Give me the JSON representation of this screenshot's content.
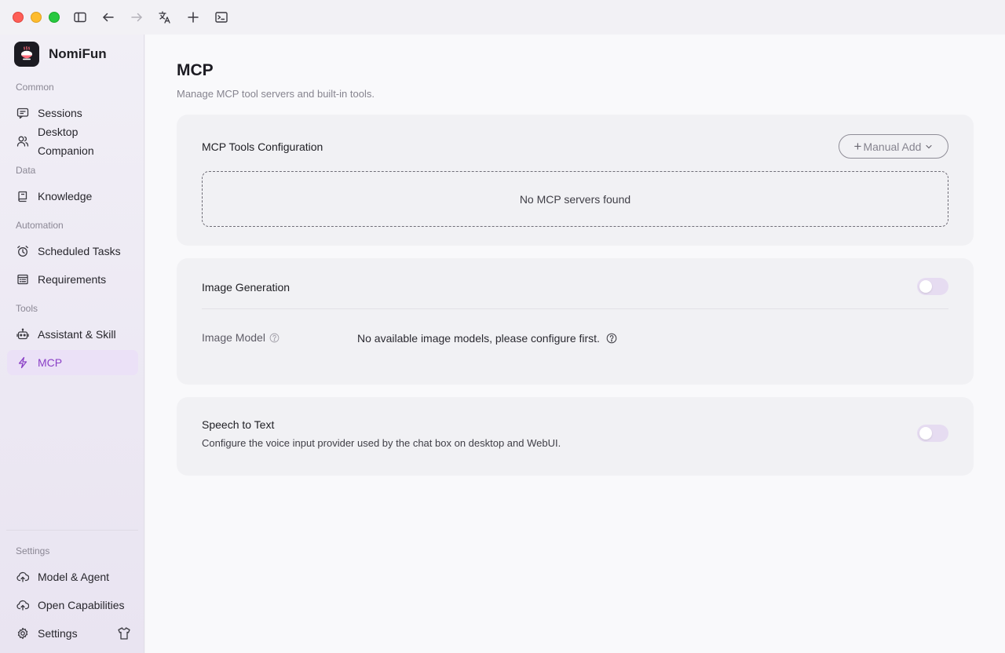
{
  "app": {
    "name": "NomiFun"
  },
  "sidebar": {
    "sections": {
      "common": "Common",
      "data": "Data",
      "automation": "Automation",
      "tools": "Tools",
      "settings": "Settings"
    },
    "items": {
      "sessions": "Sessions",
      "desktop_companion": "Desktop Companion",
      "knowledge": "Knowledge",
      "scheduled_tasks": "Scheduled Tasks",
      "requirements": "Requirements",
      "assistant_skill": "Assistant & Skill",
      "mcp": "MCP",
      "model_agent": "Model & Agent",
      "open_capabilities": "Open Capabilities",
      "settings": "Settings"
    },
    "active_item": "mcp"
  },
  "main": {
    "title": "MCP",
    "subtitle": "Manage MCP tool servers and built-in tools.",
    "mcp_card": {
      "title": "MCP Tools Configuration",
      "add_button": "Manual Add",
      "empty_text": "No MCP servers found"
    },
    "image_card": {
      "title": "Image Generation",
      "enabled": false,
      "model_label": "Image Model",
      "model_value": "No available image models, please configure first."
    },
    "speech_card": {
      "title": "Speech to Text",
      "description": "Configure the voice input provider used by the chat box on desktop and WebUI.",
      "enabled": false
    }
  },
  "colors": {
    "accent": "#8a3fc6",
    "active_bg": "#ebe1f7",
    "toggle_off": "#e6dcf1"
  }
}
